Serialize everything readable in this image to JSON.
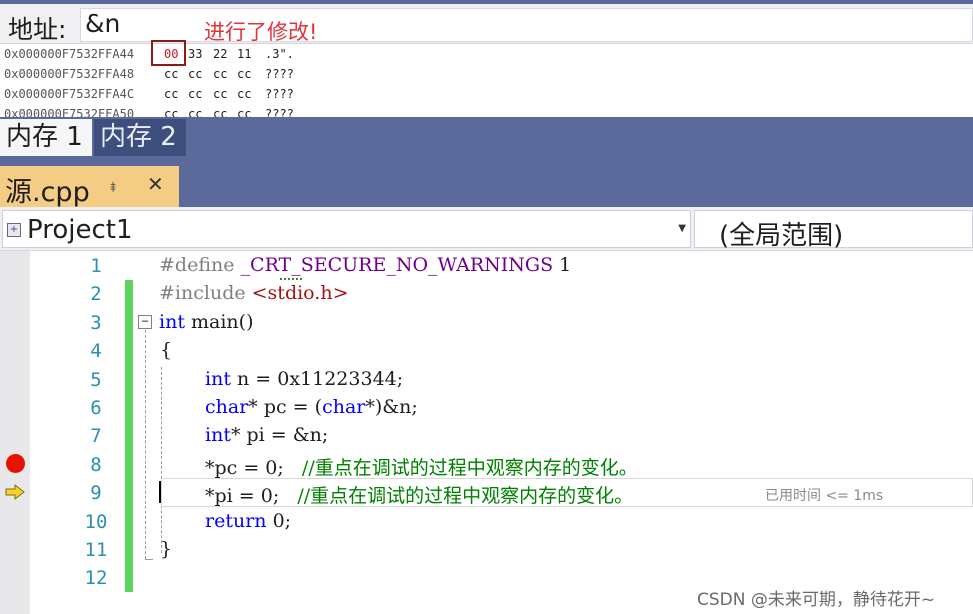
{
  "memory_window": {
    "address_label": "地址:",
    "address_value": "&n",
    "annotation": "进行了修改!",
    "rows": [
      {
        "address": "0x000000F7532FFA44",
        "bytes": [
          "00",
          "33",
          "22",
          "11"
        ],
        "ascii": ".3\"."
      },
      {
        "address": "0x000000F7532FFA48",
        "bytes": [
          "cc",
          "cc",
          "cc",
          "cc"
        ],
        "ascii": "????"
      },
      {
        "address": "0x000000F7532FFA4C",
        "bytes": [
          "cc",
          "cc",
          "cc",
          "cc"
        ],
        "ascii": "????"
      },
      {
        "address": "0x000000F7532FFA50",
        "bytes": [
          "cc",
          "cc",
          "cc",
          "cc"
        ],
        "ascii": "????"
      }
    ],
    "tabs": [
      "内存 1",
      "内存 2"
    ]
  },
  "editor": {
    "tab_label": "源.cpp",
    "pin_icon": "pin-icon",
    "close_icon": "close-icon",
    "project": "Project1",
    "scope": "(全局范围)",
    "line_numbers": [
      "1",
      "2",
      "3",
      "4",
      "5",
      "6",
      "7",
      "8",
      "9",
      "10",
      "11",
      "12"
    ],
    "lines": {
      "l1_pp": "#define ",
      "l1_mac": "_CRT_SECURE_NO_WARNINGS",
      "l1_rest": " 1",
      "l2_pp": "#include ",
      "l2_str": "<stdio.h>",
      "l3_kw": "int",
      "l3_rest": " main()",
      "l4": "{",
      "l5_kw": "int",
      "l5_rest": " n = 0x11223344;",
      "l6_kw": "char",
      "l6_mid": "* pc = (",
      "l6_kw2": "char",
      "l6_rest": "*)&n;",
      "l7_kw": "int",
      "l7_rest": "* pi = &n;",
      "l8_code": "*pc = 0;   ",
      "l8_cmt": "//重点在调试的过程中观察内存的变化。",
      "l9_code": "*pi = 0;   ",
      "l9_cmt": "//重点在调试的过程中观察内存的变化。",
      "l10_kw": "return",
      "l10_rest": " 0;",
      "l11": "}"
    },
    "timing_hint": "已用时间 <= 1ms",
    "watermark": "CSDN @未来可期，静待花开~"
  },
  "colors": {
    "keyword": "#0000ff",
    "preprocessor": "#808080",
    "string": "#a31515",
    "macro": "#6f008a",
    "comment": "#008000",
    "line_number": "#2b91af",
    "active_tab": "#f5cc84",
    "chrome": "#5b6a9a",
    "breakpoint": "#e51400"
  }
}
